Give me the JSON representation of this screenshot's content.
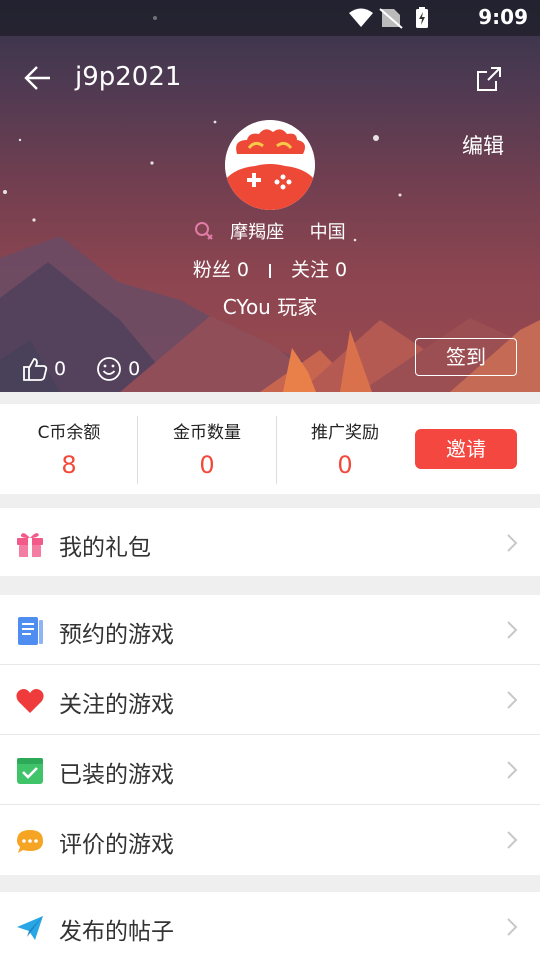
{
  "status_bar": {
    "time": "9:09",
    "icons": [
      "wifi-icon",
      "no-sim-icon",
      "battery-charging-icon"
    ]
  },
  "header": {
    "username": "j9p2021",
    "edit_label": "编辑",
    "zodiac": "摩羯座",
    "region": "中国",
    "fans": "粉丝 0",
    "following": "关注 0",
    "level": "CYou 玩家",
    "likes_count": "0",
    "smile_count": "0",
    "signin_label": "签到"
  },
  "stats": {
    "items": [
      {
        "label": "C币余额",
        "value": "8"
      },
      {
        "label": "金币数量",
        "value": "0"
      },
      {
        "label": "推广奖励",
        "value": "0"
      }
    ],
    "invite_label": "邀请"
  },
  "menu": {
    "gift": "我的礼包",
    "reserved": "预约的游戏",
    "followed": "关注的游戏",
    "installed": "已装的游戏",
    "reviewed": "评价的游戏",
    "posts": "发布的帖子"
  },
  "colors": {
    "accent": "#f4473f",
    "value_red": "#f2493b"
  }
}
